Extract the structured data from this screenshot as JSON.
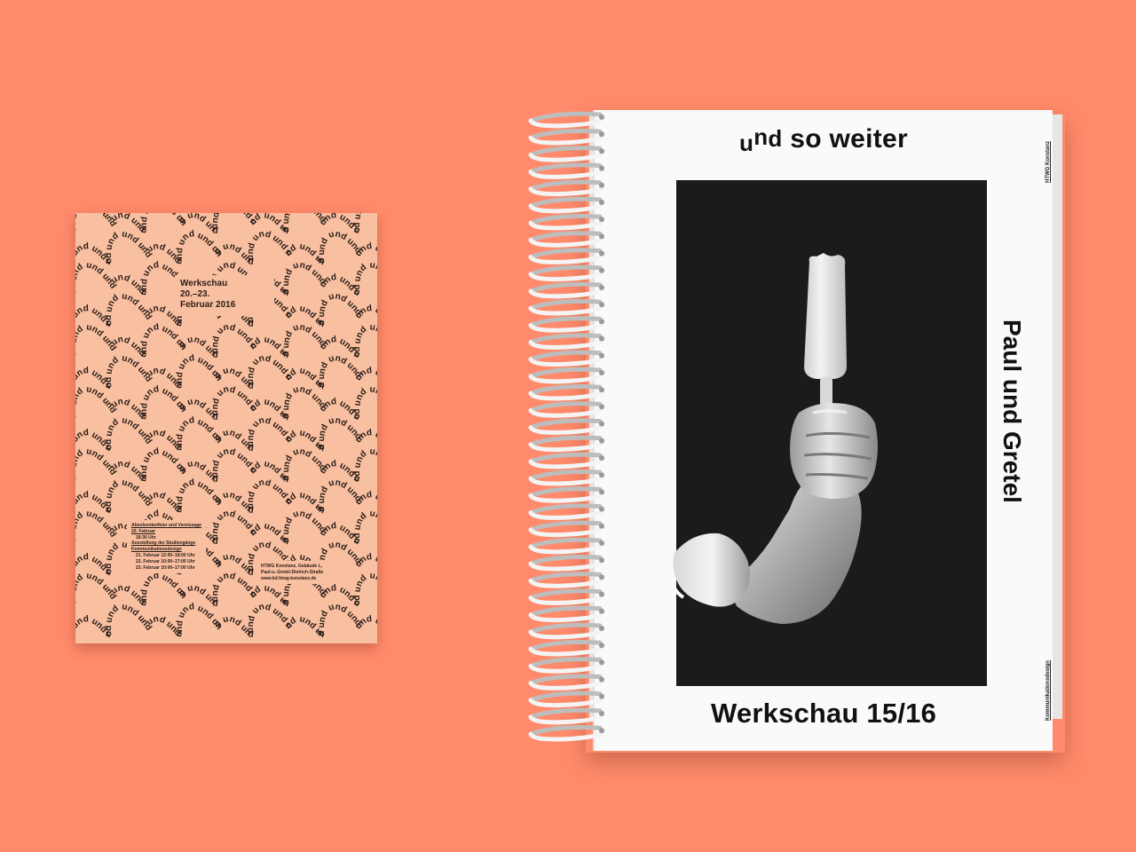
{
  "background_color": "#ff8b6c",
  "poster": {
    "paper_color": "#f8bfa0",
    "ink_color": "#2a1d18",
    "pattern_word": "und",
    "headline": {
      "line1": "Werkschau",
      "line2": "20.–23.",
      "line3": "Februar 2016"
    },
    "schedule": {
      "line1": "Absolventenfeier und Vernissage",
      "line2": "20. Februar",
      "line3": "18:30 Uhr",
      "line4": "Ausstellung der Studiengänge",
      "line5": "Kommunikationsdesign",
      "line6": "21. Februar 12:00–18:00 Uhr",
      "line7": "22. Februar 10:00–17:00 Uhr",
      "line8": "23. Februar 10:00–17:00 Uhr"
    },
    "venue": {
      "line1": "HTWG Konstanz, Gebäude L,",
      "line2": "Paul-u.-Gretel-Dietrich-Straße",
      "line3": "www.kd.htwg-konstanz.de"
    }
  },
  "book": {
    "cover_color": "#fafafa",
    "photo_background": "#1b1b1b",
    "title_und": "und",
    "title_rest": " so weiter",
    "side_title": "Paul und Gretel",
    "subtitle": "Werkschau 15/16",
    "spine_top": "HTWG Konstanz",
    "spine_bottom": "Kommunikationsdesign",
    "photo_subject": "arm-holding-popsicle"
  }
}
